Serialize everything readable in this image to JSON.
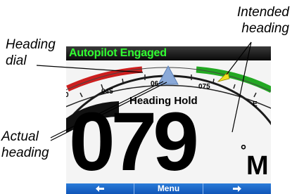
{
  "callouts": {
    "heading_dial": [
      "Heading",
      "dial"
    ],
    "actual_heading": [
      "Actual",
      "heading"
    ],
    "intended_heading": [
      "Intended",
      "heading"
    ]
  },
  "screen": {
    "status_title": "Autopilot Engaged",
    "mode": "Heading Hold",
    "heading_value": "079",
    "degree_symbol": "°",
    "heading_unit": "M",
    "dial_labels": [
      "0",
      "045",
      "06",
      "075",
      "E"
    ],
    "softkeys": {
      "left_icon": "left-arrow-icon",
      "menu_label": "Menu",
      "right_icon": "right-arrow-icon"
    }
  },
  "colors": {
    "title_text": "#32ff32",
    "port_band": "#cc1f1f",
    "starboard_band": "#23a823",
    "intended_marker": "#f0e020",
    "actual_marker": "#8aa9d8",
    "softkey_bg": "#1a64c8"
  }
}
